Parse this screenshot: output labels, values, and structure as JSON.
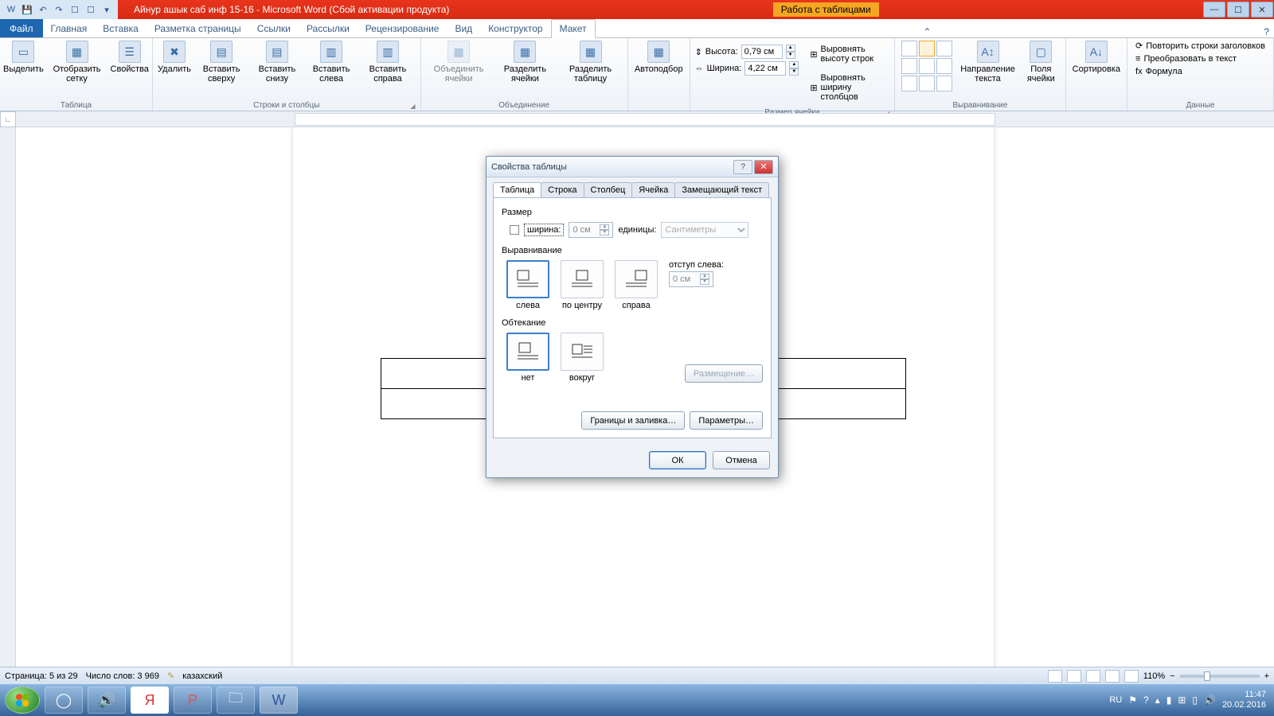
{
  "title": {
    "doc": "Айнур ашык саб инф 15-16  -  Microsoft Word (Сбой активации продукта)",
    "context": "Работа с таблицами"
  },
  "tabs": {
    "file": "Файл",
    "items": [
      "Главная",
      "Вставка",
      "Разметка страницы",
      "Ссылки",
      "Рассылки",
      "Рецензирование",
      "Вид",
      "Конструктор",
      "Макет"
    ]
  },
  "ribbon": {
    "table": {
      "select": "Выделить",
      "grid": "Отобразить сетку",
      "props": "Свойства",
      "label": "Таблица"
    },
    "rows": {
      "delete": "Удалить",
      "above": "Вставить сверху",
      "below": "Вставить снизу",
      "left": "Вставить слева",
      "right": "Вставить справа",
      "label": "Строки и столбцы"
    },
    "merge": {
      "merge": "Объединить ячейки",
      "splitc": "Разделить ячейки",
      "splitt": "Разделить таблицу",
      "label": "Объединение"
    },
    "auto": {
      "autofit": "Автоподбор"
    },
    "size": {
      "h": "Высота:",
      "hval": "0,79 см",
      "w": "Ширина:",
      "wval": "4,22 см",
      "eqh": "Выровнять высоту строк",
      "eqw": "Выровнять ширину столбцов",
      "label": "Размер ячейки"
    },
    "align": {
      "dir": "Направление текста",
      "margins": "Поля ячейки",
      "label": "Выравнивание"
    },
    "sort": {
      "sort": "Сортировка"
    },
    "data": {
      "repeat": "Повторить строки заголовков",
      "convert": "Преобразовать в текст",
      "formula": "Формула",
      "label": "Данные"
    }
  },
  "dialog": {
    "title": "Свойства таблицы",
    "tabs": [
      "Таблица",
      "Строка",
      "Столбец",
      "Ячейка",
      "Замещающий текст"
    ],
    "size_label": "Размер",
    "width_chk": "ширина:",
    "width_val": "0 см",
    "units_label": "единицы:",
    "units_val": "Сантиметры",
    "align_label": "Выравнивание",
    "align_opts": [
      "слева",
      "по центру",
      "справа"
    ],
    "indent_label": "отступ слева:",
    "indent_val": "0 см",
    "wrap_label": "Обтекание",
    "wrap_opts": [
      "нет",
      "вокруг"
    ],
    "placement": "Размещение…",
    "borders": "Границы и заливка…",
    "options": "Параметры…",
    "ok": "ОК",
    "cancel": "Отмена"
  },
  "status": {
    "page": "Страница: 5 из 29",
    "words": "Число слов: 3 969",
    "lang": "казахский",
    "zoom": "110%"
  },
  "tray": {
    "lang": "RU",
    "time": "11:47",
    "date": "20.02.2016"
  }
}
